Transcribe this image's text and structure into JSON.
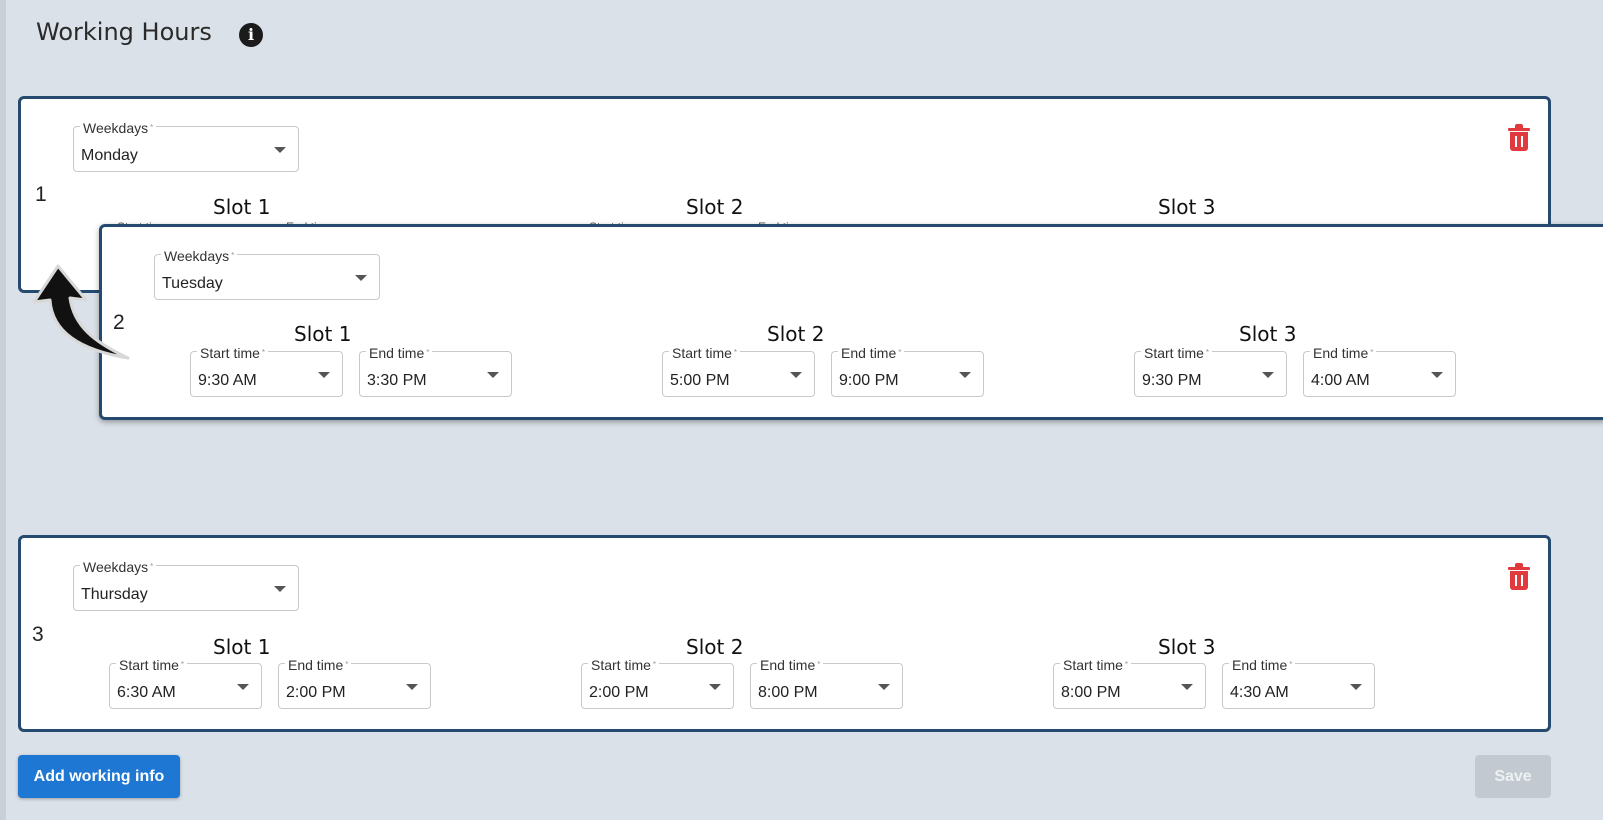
{
  "header": {
    "title": "Working Hours",
    "info_icon": "info-icon"
  },
  "labels": {
    "weekdays": "Weekdays",
    "start": "Start time",
    "end": "End time",
    "required": "*"
  },
  "rows": [
    {
      "index": "1",
      "weekday": "Monday",
      "slots": [
        {
          "title": "Slot 1"
        },
        {
          "title": "Slot 2"
        },
        {
          "title": "Slot 3"
        }
      ]
    },
    {
      "index": "2",
      "weekday": "Tuesday",
      "slots": [
        {
          "title": "Slot 1",
          "start": "9:30 AM",
          "end": "3:30 PM"
        },
        {
          "title": "Slot 2",
          "start": "5:00 PM",
          "end": "9:00 PM"
        },
        {
          "title": "Slot 3",
          "start": "9:30 PM",
          "end": "4:00 AM"
        }
      ]
    },
    {
      "index": "3",
      "weekday": "Thursday",
      "slots": [
        {
          "title": "Slot 1",
          "start": "6:30 AM",
          "end": "2:00 PM"
        },
        {
          "title": "Slot 2",
          "start": "2:00 PM",
          "end": "8:00 PM"
        },
        {
          "title": "Slot 3",
          "start": "8:00 PM",
          "end": "4:30 AM"
        }
      ]
    }
  ],
  "peek": {
    "start_partial": "Start tim",
    "end_partial": "End tim"
  },
  "buttons": {
    "add": "Add working info",
    "save": "Save"
  },
  "colors": {
    "card_border": "#244a70",
    "delete": "#e03a3e",
    "primary": "#1e77d3"
  }
}
